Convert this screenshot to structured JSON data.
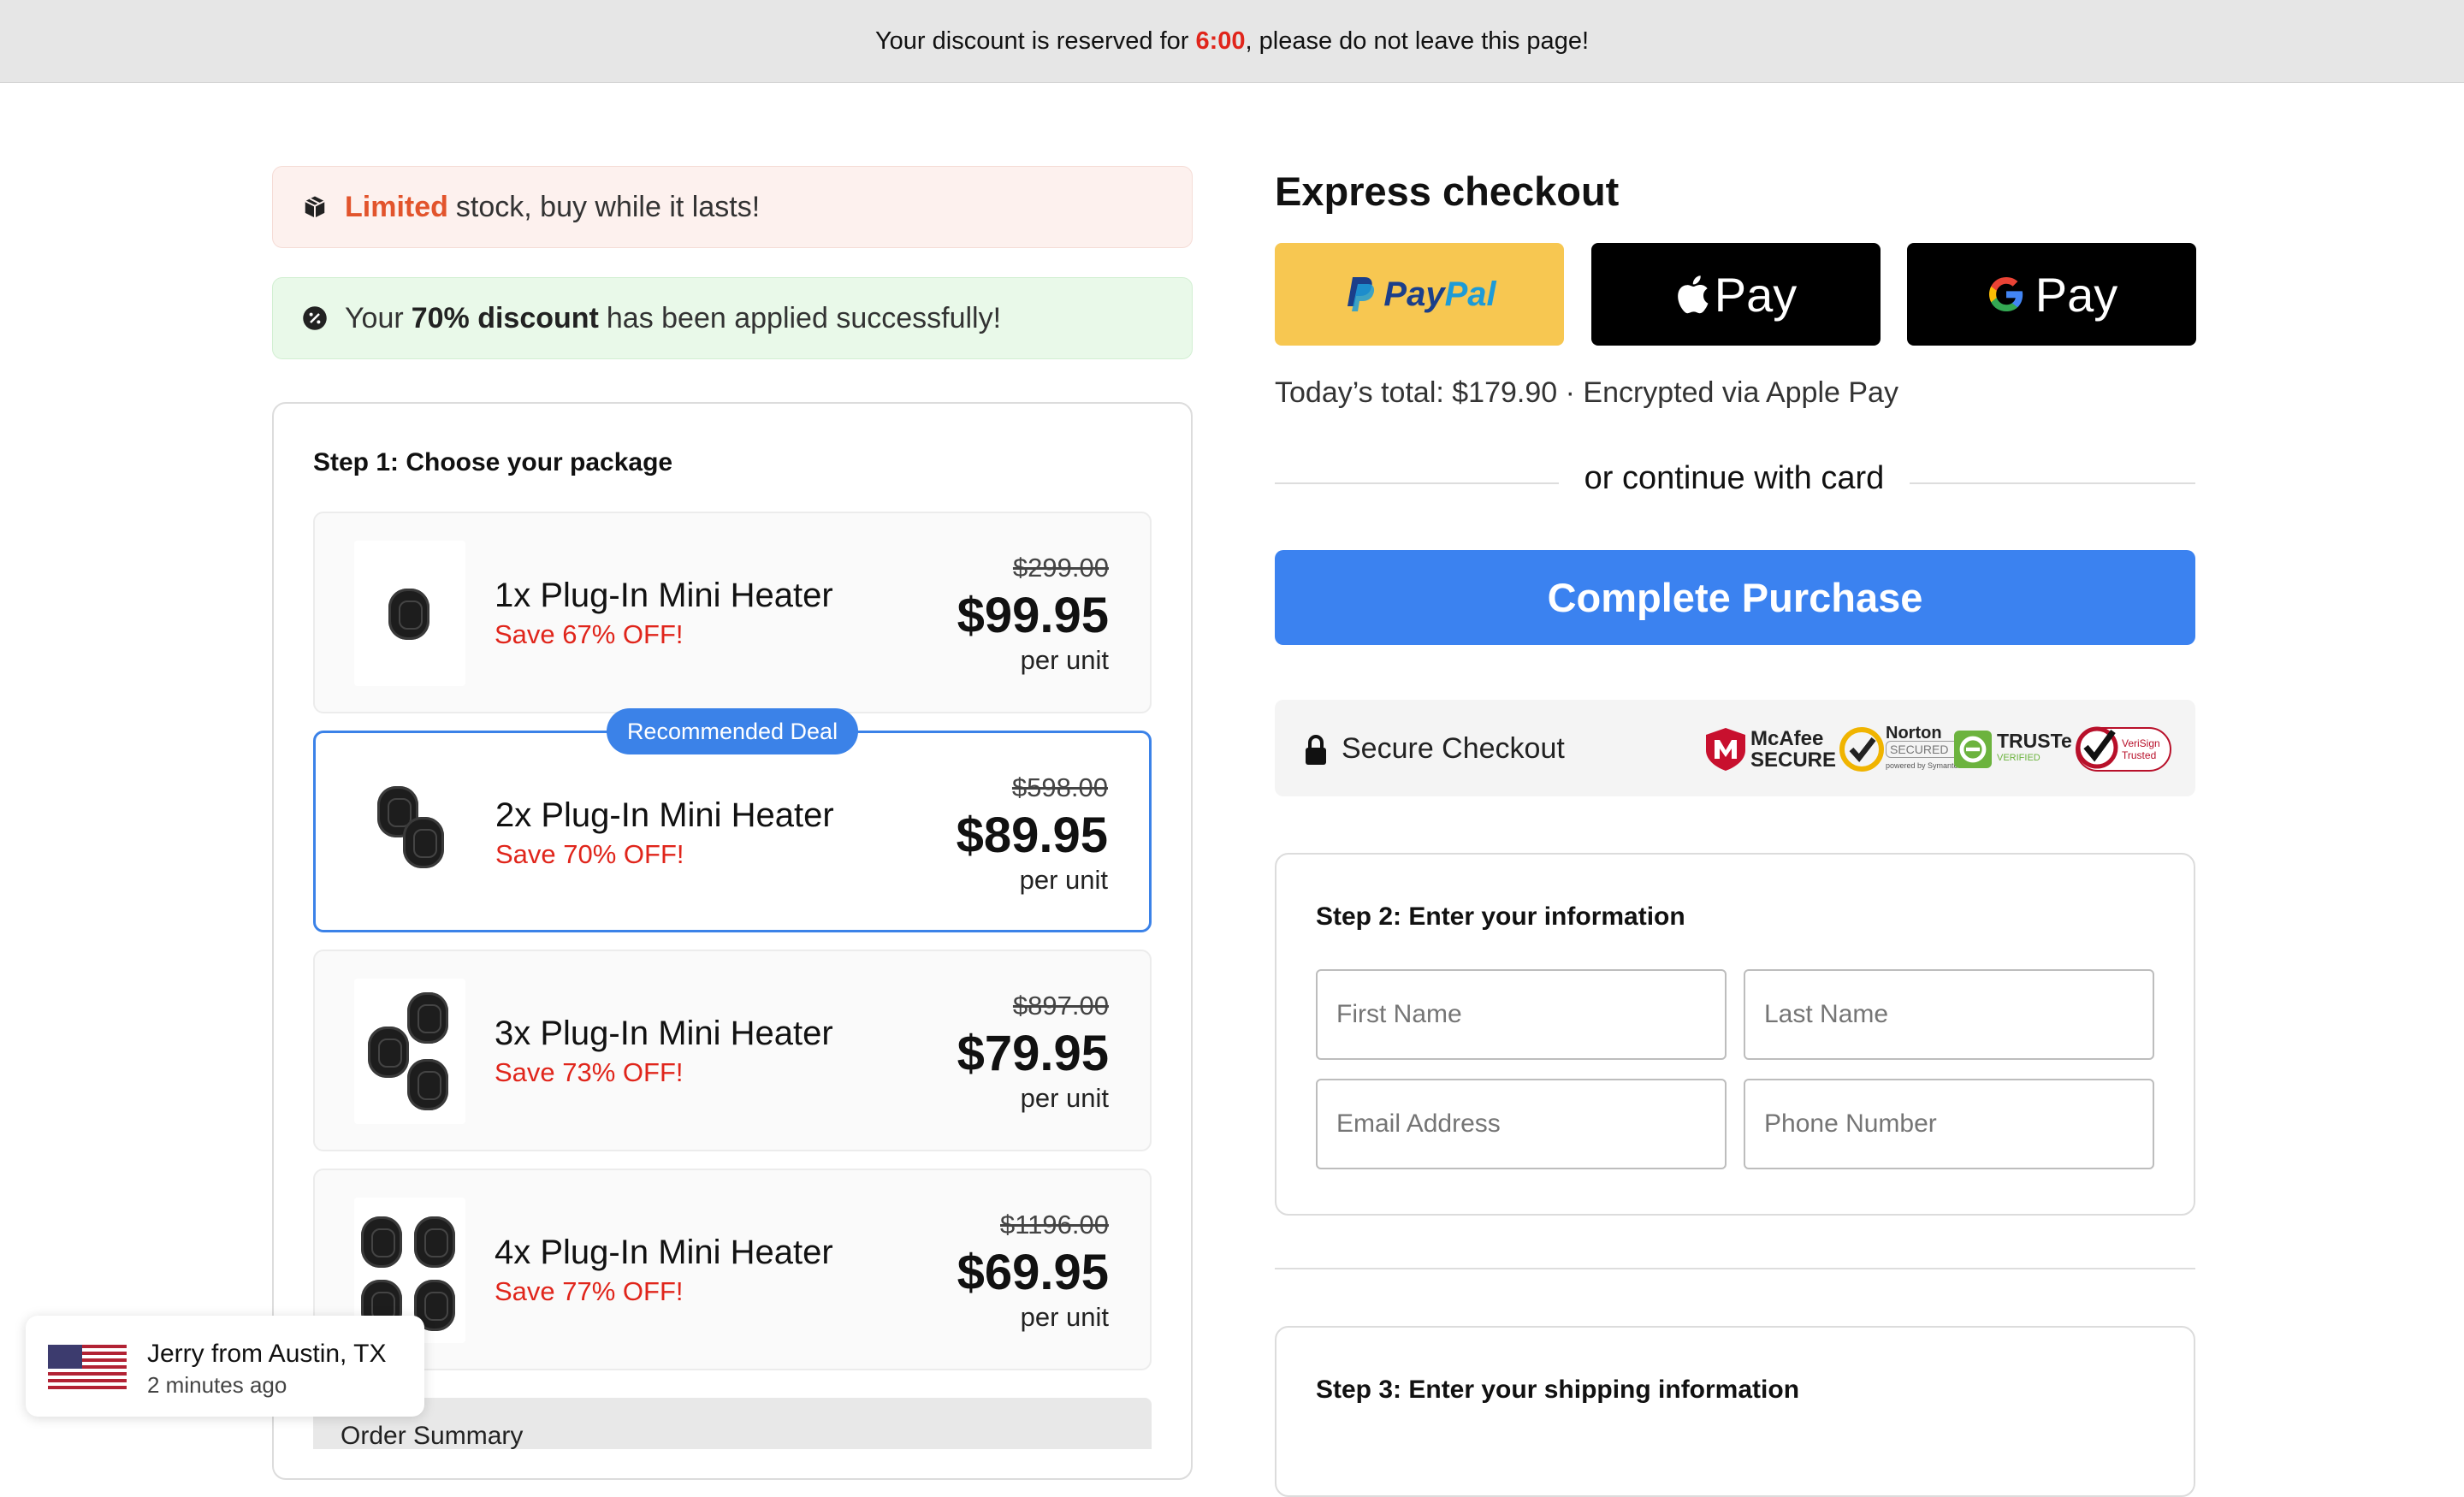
{
  "topbar": {
    "prefix": "Your discount is reserved for ",
    "timer": "6:00",
    "suffix": ", please do not leave this page!"
  },
  "notices": {
    "stock_highlight": "Limited",
    "stock_text": "stock, buy while it lasts!",
    "discount_prefix": "Your",
    "discount_bold": "70% discount",
    "discount_suffix": "has been applied successfully!"
  },
  "step1": {
    "title": "Step 1: Choose your package",
    "badge": "Recommended Deal",
    "packages": [
      {
        "name": "1x Plug-In Mini Heater",
        "save": "Save 67% OFF!",
        "old_price": "$299.00",
        "price": "$99.95",
        "unit": "per unit"
      },
      {
        "name": "2x Plug-In Mini Heater",
        "save": "Save 70% OFF!",
        "old_price": "$598.00",
        "price": "$89.95",
        "unit": "per unit"
      },
      {
        "name": "3x Plug-In Mini Heater",
        "save": "Save 73% OFF!",
        "old_price": "$897.00",
        "price": "$79.95",
        "unit": "per unit"
      },
      {
        "name": "4x Plug-In Mini Heater",
        "save": "Save 77% OFF!",
        "old_price": "$1196.00",
        "price": "$69.95",
        "unit": "per unit"
      }
    ],
    "order_summary": "Order Summary"
  },
  "toast": {
    "who": "Jerry from Austin, TX",
    "when": "2 minutes ago"
  },
  "express": {
    "title": "Express checkout",
    "paypal_a": "Pay",
    "paypal_b": "Pal",
    "applepay": "Pay",
    "googlepay": "Pay",
    "total": "Today’s total: $179.90 · Encrypted via Apple Pay",
    "or": "or continue with card",
    "complete": "Complete Purchase"
  },
  "secure": {
    "label": "Secure Checkout",
    "mcafee_a": "McAfee",
    "mcafee_b": "SECURE",
    "norton_a": "Norton",
    "norton_b": "SECURED",
    "norton_c": "powered by Symantec",
    "truste_a": "TRUSTe",
    "truste_b": "VERIFIED",
    "verisign_a": "VeriSign",
    "verisign_b": "Trusted"
  },
  "step2": {
    "title": "Step 2: Enter your information",
    "first_name": "First Name",
    "last_name": "Last Name",
    "email": "Email Address",
    "phone": "Phone Number"
  },
  "step3": {
    "title": "Step 3: Enter your shipping information"
  },
  "colors": {
    "accent_blue": "#3b82f0",
    "sale_red": "#e0251b",
    "paypal_yellow": "#f7c751"
  }
}
